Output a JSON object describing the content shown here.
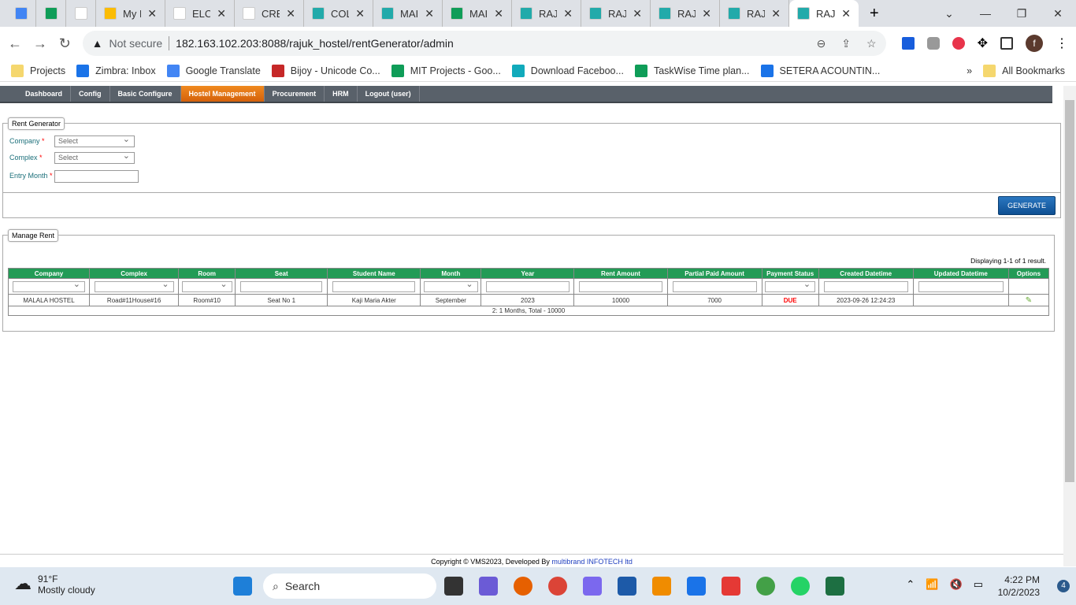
{
  "browser": {
    "tabs": [
      {
        "label": ""
      },
      {
        "label": ""
      },
      {
        "label": ""
      },
      {
        "label": "My Drive"
      },
      {
        "label": "ELCO"
      },
      {
        "label": "CRE"
      },
      {
        "label": "COL"
      },
      {
        "label": "MAI"
      },
      {
        "label": "MAI"
      },
      {
        "label": "RAJ"
      },
      {
        "label": "RAJ"
      },
      {
        "label": "RAJ"
      },
      {
        "label": "RAJ"
      },
      {
        "label": "RAJ"
      }
    ],
    "not_secure": "Not secure",
    "url": "182.163.102.203:8088/rajuk_hostel/rentGenerator/admin",
    "bookmarks": [
      "Projects",
      "Zimbra: Inbox",
      "Google Translate",
      "Bijoy - Unicode Co...",
      "MIT Projects - Goo...",
      "Download Faceboo...",
      "TaskWise Time plan...",
      "SETERA ACOUNTIN..."
    ],
    "all_bookmarks": "All Bookmarks",
    "profile": "f"
  },
  "menu": [
    "Dashboard",
    "Config",
    "Basic Configure",
    "Hostel Management",
    "Procurement",
    "HRM",
    "Logout (user)"
  ],
  "rent_generator": {
    "legend": "Rent Generator",
    "company_label": "Company",
    "complex_label": "Complex",
    "entry_month_label": "Entry Month",
    "required": "*",
    "company_value": "Select",
    "complex_value": "Select",
    "entry_month_value": "",
    "generate": "GENERATE"
  },
  "manage_rent": {
    "legend": "Manage Rent",
    "summary": "Displaying 1-1 of 1 result.",
    "columns": [
      "Company",
      "Complex",
      "Room",
      "Seat",
      "Student Name",
      "Month",
      "Year",
      "Rent Amount",
      "Partial Paid Amount",
      "Payment Status",
      "Created Datetime",
      "Updated Datetime",
      "Options"
    ],
    "rows": [
      [
        "MALALA HOSTEL",
        "Road#11House#16",
        "Room#10",
        "Seat No 1",
        "Kaji Maria Akter",
        "September",
        "2023",
        "10000",
        "7000",
        "DUE",
        "2023-09-26 12:24:23",
        ""
      ]
    ],
    "total": "2: 1 Months, Total - 10000"
  },
  "footer": {
    "text": "Copyright © VMS2023, Developed By ",
    "link": "multibrand INFOTECH ltd"
  },
  "taskbar": {
    "temp": "91°F",
    "weather": "Mostly cloudy",
    "search": "Search",
    "time": "4:22 PM",
    "date": "10/2/2023",
    "badge": "4"
  }
}
